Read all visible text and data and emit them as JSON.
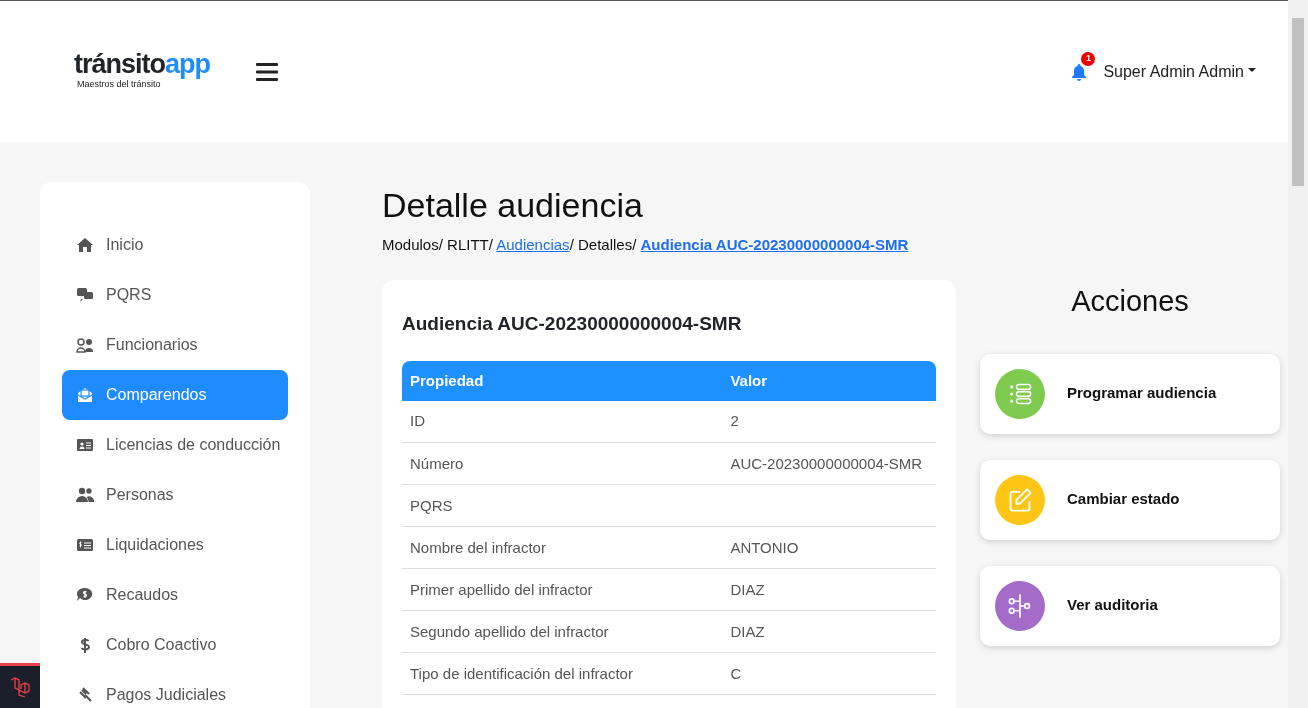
{
  "header": {
    "logo": {
      "brand_dark": "tránsito",
      "brand_accent": "app",
      "tagline": "Maestros del tránsito"
    },
    "notifications": {
      "count": "1"
    },
    "user": {
      "name": "Super Admin Admin"
    }
  },
  "sidebar": {
    "items": [
      {
        "label": "Inicio",
        "selected": false
      },
      {
        "label": "PQRS",
        "selected": false
      },
      {
        "label": "Funcionarios",
        "selected": false
      },
      {
        "label": "Comparendos",
        "selected": true
      },
      {
        "label": "Licencias de conducción",
        "selected": false
      },
      {
        "label": "Personas",
        "selected": false
      },
      {
        "label": "Liquidaciones",
        "selected": false
      },
      {
        "label": "Recaudos",
        "selected": false
      },
      {
        "label": "Cobro Coactivo",
        "selected": false
      },
      {
        "label": "Pagos Judiciales",
        "selected": false
      }
    ]
  },
  "page": {
    "title": "Detalle audiencia",
    "breadcrumb_separator": "/",
    "breadcrumb": [
      {
        "label": "Modulos",
        "kind": "text"
      },
      {
        "label": "RLITT",
        "kind": "text"
      },
      {
        "label": "Audiencias",
        "kind": "link"
      },
      {
        "label": "Detalles",
        "kind": "text"
      },
      {
        "label": "Audiencia AUC-20230000000004-SMR",
        "kind": "current"
      }
    ]
  },
  "detail_card": {
    "title": "Audiencia AUC-20230000000004-SMR",
    "table": {
      "columns": [
        "Propiedad",
        "Valor"
      ],
      "rows": [
        [
          "ID",
          "2"
        ],
        [
          "Número",
          "AUC-20230000000004-SMR"
        ],
        [
          "PQRS",
          ""
        ],
        [
          "Nombre del infractor",
          "ANTONIO"
        ],
        [
          "Primer apellido del infractor",
          "DIAZ"
        ],
        [
          "Segundo apellido del infractor",
          "DIAZ"
        ],
        [
          "Tipo de identificación del infractor",
          "C"
        ]
      ]
    }
  },
  "actions": {
    "title": "Acciones",
    "items": [
      {
        "label": "Programar audiencia",
        "color": "#7ecb4f"
      },
      {
        "label": "Cambiar estado",
        "color": "#fdc614"
      },
      {
        "label": "Ver auditoria",
        "color": "#a56bc9"
      }
    ]
  }
}
